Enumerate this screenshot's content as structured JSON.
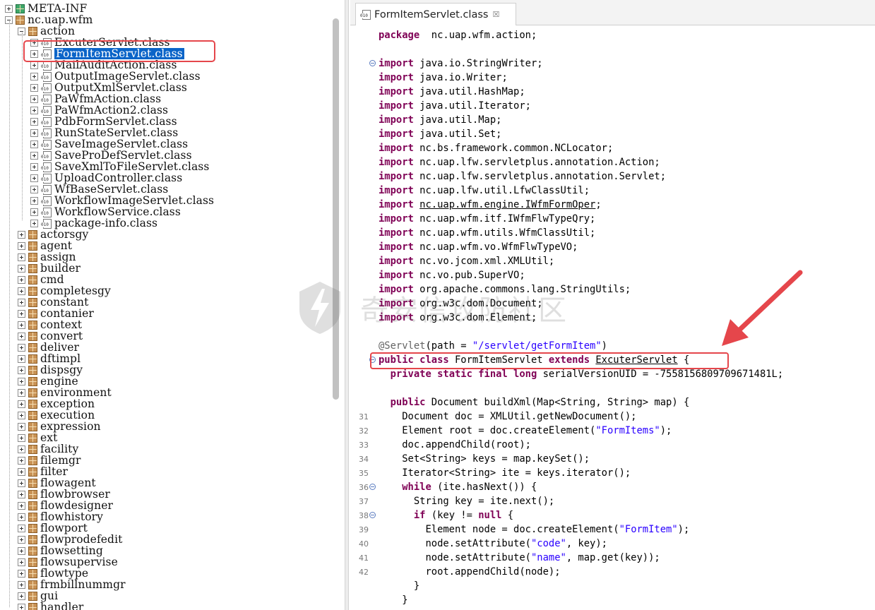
{
  "tree": {
    "items": [
      {
        "label": "META-INF",
        "level": 0,
        "expander": "plus",
        "icon": "package-green"
      },
      {
        "label": "nc.uap.wfm",
        "level": 0,
        "expander": "minus",
        "icon": "package"
      },
      {
        "label": "action",
        "level": 1,
        "expander": "minus",
        "icon": "package"
      },
      {
        "label": "ExcuterServlet.class",
        "level": 2,
        "expander": "plus",
        "icon": "class"
      },
      {
        "label": "FormItemServlet.class",
        "level": 2,
        "expander": "plus",
        "icon": "class",
        "selected": true
      },
      {
        "label": "MailAuditAction.class",
        "level": 2,
        "expander": "plus",
        "icon": "class"
      },
      {
        "label": "OutputImageServlet.class",
        "level": 2,
        "expander": "plus",
        "icon": "class"
      },
      {
        "label": "OutputXmlServlet.class",
        "level": 2,
        "expander": "plus",
        "icon": "class"
      },
      {
        "label": "PaWfmAction.class",
        "level": 2,
        "expander": "plus",
        "icon": "class"
      },
      {
        "label": "PaWfmAction2.class",
        "level": 2,
        "expander": "plus",
        "icon": "class"
      },
      {
        "label": "PdbFormServlet.class",
        "level": 2,
        "expander": "plus",
        "icon": "class"
      },
      {
        "label": "RunStateServlet.class",
        "level": 2,
        "expander": "plus",
        "icon": "class"
      },
      {
        "label": "SaveImageServlet.class",
        "level": 2,
        "expander": "plus",
        "icon": "class"
      },
      {
        "label": "SaveProDefServlet.class",
        "level": 2,
        "expander": "plus",
        "icon": "class"
      },
      {
        "label": "SaveXmlToFileServlet.class",
        "level": 2,
        "expander": "plus",
        "icon": "class"
      },
      {
        "label": "UploadController.class",
        "level": 2,
        "expander": "plus",
        "icon": "class"
      },
      {
        "label": "WfBaseServlet.class",
        "level": 2,
        "expander": "plus",
        "icon": "class"
      },
      {
        "label": "WorkflowImageServlet.class",
        "level": 2,
        "expander": "plus",
        "icon": "class"
      },
      {
        "label": "WorkflowService.class",
        "level": 2,
        "expander": "plus",
        "icon": "class"
      },
      {
        "label": "package-info.class",
        "level": 2,
        "expander": "plus",
        "icon": "class"
      },
      {
        "label": "actorsgy",
        "level": 1,
        "expander": "plus",
        "icon": "package"
      },
      {
        "label": "agent",
        "level": 1,
        "expander": "plus",
        "icon": "package"
      },
      {
        "label": "assign",
        "level": 1,
        "expander": "plus",
        "icon": "package"
      },
      {
        "label": "builder",
        "level": 1,
        "expander": "plus",
        "icon": "package"
      },
      {
        "label": "cmd",
        "level": 1,
        "expander": "plus",
        "icon": "package"
      },
      {
        "label": "completesgy",
        "level": 1,
        "expander": "plus",
        "icon": "package"
      },
      {
        "label": "constant",
        "level": 1,
        "expander": "plus",
        "icon": "package"
      },
      {
        "label": "contanier",
        "level": 1,
        "expander": "plus",
        "icon": "package"
      },
      {
        "label": "context",
        "level": 1,
        "expander": "plus",
        "icon": "package"
      },
      {
        "label": "convert",
        "level": 1,
        "expander": "plus",
        "icon": "package"
      },
      {
        "label": "deliver",
        "level": 1,
        "expander": "plus",
        "icon": "package"
      },
      {
        "label": "dftimpl",
        "level": 1,
        "expander": "plus",
        "icon": "package"
      },
      {
        "label": "dispsgy",
        "level": 1,
        "expander": "plus",
        "icon": "package"
      },
      {
        "label": "engine",
        "level": 1,
        "expander": "plus",
        "icon": "package"
      },
      {
        "label": "environment",
        "level": 1,
        "expander": "plus",
        "icon": "package"
      },
      {
        "label": "exception",
        "level": 1,
        "expander": "plus",
        "icon": "package"
      },
      {
        "label": "execution",
        "level": 1,
        "expander": "plus",
        "icon": "package"
      },
      {
        "label": "expression",
        "level": 1,
        "expander": "plus",
        "icon": "package"
      },
      {
        "label": "ext",
        "level": 1,
        "expander": "plus",
        "icon": "package"
      },
      {
        "label": "facility",
        "level": 1,
        "expander": "plus",
        "icon": "package"
      },
      {
        "label": "filemgr",
        "level": 1,
        "expander": "plus",
        "icon": "package"
      },
      {
        "label": "filter",
        "level": 1,
        "expander": "plus",
        "icon": "package"
      },
      {
        "label": "flowagent",
        "level": 1,
        "expander": "plus",
        "icon": "package"
      },
      {
        "label": "flowbrowser",
        "level": 1,
        "expander": "plus",
        "icon": "package"
      },
      {
        "label": "flowdesigner",
        "level": 1,
        "expander": "plus",
        "icon": "package"
      },
      {
        "label": "flowhistory",
        "level": 1,
        "expander": "plus",
        "icon": "package"
      },
      {
        "label": "flowport",
        "level": 1,
        "expander": "plus",
        "icon": "package"
      },
      {
        "label": "flowprodefedit",
        "level": 1,
        "expander": "plus",
        "icon": "package"
      },
      {
        "label": "flowsetting",
        "level": 1,
        "expander": "plus",
        "icon": "package"
      },
      {
        "label": "flowsupervise",
        "level": 1,
        "expander": "plus",
        "icon": "package"
      },
      {
        "label": "flowtype",
        "level": 1,
        "expander": "plus",
        "icon": "package"
      },
      {
        "label": "frmbillnummgr",
        "level": 1,
        "expander": "plus",
        "icon": "package"
      },
      {
        "label": "gui",
        "level": 1,
        "expander": "plus",
        "icon": "package"
      },
      {
        "label": "handler",
        "level": 1,
        "expander": "plus",
        "icon": "package"
      }
    ]
  },
  "editor": {
    "tab_title": "FormItemServlet.class",
    "tab_close": "☒",
    "lines": [
      {
        "num": "",
        "fold": false,
        "segs": [
          [
            "kw",
            "package"
          ],
          [
            "",
            "  nc.uap.wfm.action;"
          ]
        ]
      },
      {
        "num": "",
        "fold": false,
        "segs": []
      },
      {
        "num": "",
        "fold": true,
        "segs": [
          [
            "kw",
            "import"
          ],
          [
            "",
            " java.io.StringWriter;"
          ]
        ]
      },
      {
        "num": "",
        "fold": false,
        "segs": [
          [
            "kw",
            "import"
          ],
          [
            "",
            " java.io.Writer;"
          ]
        ]
      },
      {
        "num": "",
        "fold": false,
        "segs": [
          [
            "kw",
            "import"
          ],
          [
            "",
            " java.util.HashMap;"
          ]
        ]
      },
      {
        "num": "",
        "fold": false,
        "segs": [
          [
            "kw",
            "import"
          ],
          [
            "",
            " java.util.Iterator;"
          ]
        ]
      },
      {
        "num": "",
        "fold": false,
        "segs": [
          [
            "kw",
            "import"
          ],
          [
            "",
            " java.util.Map;"
          ]
        ]
      },
      {
        "num": "",
        "fold": false,
        "segs": [
          [
            "kw",
            "import"
          ],
          [
            "",
            " java.util.Set;"
          ]
        ]
      },
      {
        "num": "",
        "fold": false,
        "segs": [
          [
            "kw",
            "import"
          ],
          [
            "",
            " nc.bs.framework.common.NCLocator;"
          ]
        ]
      },
      {
        "num": "",
        "fold": false,
        "segs": [
          [
            "kw",
            "import"
          ],
          [
            "",
            " nc.uap.lfw.servletplus.annotation.Action;"
          ]
        ]
      },
      {
        "num": "",
        "fold": false,
        "segs": [
          [
            "kw",
            "import"
          ],
          [
            "",
            " nc.uap.lfw.servletplus.annotation.Servlet;"
          ]
        ]
      },
      {
        "num": "",
        "fold": false,
        "segs": [
          [
            "kw",
            "import"
          ],
          [
            "",
            " nc.uap.lfw.util.LfwClassUtil;"
          ]
        ]
      },
      {
        "num": "",
        "fold": false,
        "segs": [
          [
            "kw",
            "import"
          ],
          [
            "",
            " "
          ],
          [
            "ul",
            "nc.uap.wfm.engine.IWfmFormOper"
          ],
          [
            "",
            ";"
          ]
        ]
      },
      {
        "num": "",
        "fold": false,
        "segs": [
          [
            "kw",
            "import"
          ],
          [
            "",
            " nc.uap.wfm.itf.IWfmFlwTypeQry;"
          ]
        ]
      },
      {
        "num": "",
        "fold": false,
        "segs": [
          [
            "kw",
            "import"
          ],
          [
            "",
            " nc.uap.wfm.utils.WfmClassUtil;"
          ]
        ]
      },
      {
        "num": "",
        "fold": false,
        "segs": [
          [
            "kw",
            "import"
          ],
          [
            "",
            " nc.uap.wfm.vo.WfmFlwTypeVO;"
          ]
        ]
      },
      {
        "num": "",
        "fold": false,
        "segs": [
          [
            "kw",
            "import"
          ],
          [
            "",
            " nc.vo.jcom.xml.XMLUtil;"
          ]
        ]
      },
      {
        "num": "",
        "fold": false,
        "segs": [
          [
            "kw",
            "import"
          ],
          [
            "",
            " nc.vo.pub.SuperVO;"
          ]
        ]
      },
      {
        "num": "",
        "fold": false,
        "segs": [
          [
            "kw",
            "import"
          ],
          [
            "",
            " org.apache.commons.lang.StringUtils;"
          ]
        ]
      },
      {
        "num": "",
        "fold": false,
        "segs": [
          [
            "kw",
            "import"
          ],
          [
            "",
            " org.w3c.dom.Document;"
          ]
        ]
      },
      {
        "num": "",
        "fold": false,
        "segs": [
          [
            "kw",
            "import"
          ],
          [
            "",
            " org.w3c.dom.Element;"
          ]
        ]
      },
      {
        "num": "",
        "fold": false,
        "segs": []
      },
      {
        "num": "",
        "fold": false,
        "segs": [
          [
            "ann",
            "@Servlet"
          ],
          [
            "",
            "(path = "
          ],
          [
            "str",
            "\"/servlet/getFormItem\""
          ],
          [
            "",
            ")"
          ]
        ]
      },
      {
        "num": "",
        "fold": true,
        "segs": [
          [
            "kw",
            "public class"
          ],
          [
            "",
            " FormItemServlet "
          ],
          [
            "kw",
            "extends"
          ],
          [
            "",
            " "
          ],
          [
            "ul",
            "ExcuterServlet"
          ],
          [
            "",
            " {"
          ]
        ]
      },
      {
        "num": "",
        "fold": false,
        "segs": [
          [
            "",
            "  "
          ],
          [
            "kw",
            "private static final long"
          ],
          [
            "",
            " serialVersionUID = -7558156809709671481L;"
          ]
        ]
      },
      {
        "num": "",
        "fold": false,
        "segs": []
      },
      {
        "num": "",
        "fold": false,
        "segs": [
          [
            "",
            "  "
          ],
          [
            "kw",
            "public"
          ],
          [
            "",
            " Document buildXml(Map<String, String> map) {"
          ]
        ]
      },
      {
        "num": "31",
        "fold": false,
        "segs": [
          [
            "",
            "    Document doc = XMLUtil.getNewDocument();"
          ]
        ]
      },
      {
        "num": "32",
        "fold": false,
        "segs": [
          [
            "",
            "    Element root = doc.createElement("
          ],
          [
            "str",
            "\"FormItems\""
          ],
          [
            "",
            ");"
          ]
        ]
      },
      {
        "num": "33",
        "fold": false,
        "segs": [
          [
            "",
            "    doc.appendChild(root);"
          ]
        ]
      },
      {
        "num": "34",
        "fold": false,
        "segs": [
          [
            "",
            "    Set<String> keys = map.keySet();"
          ]
        ]
      },
      {
        "num": "35",
        "fold": false,
        "segs": [
          [
            "",
            "    Iterator<String> ite = keys.iterator();"
          ]
        ]
      },
      {
        "num": "36",
        "fold": true,
        "segs": [
          [
            "",
            "    "
          ],
          [
            "kw",
            "while"
          ],
          [
            "",
            " (ite.hasNext()) {"
          ]
        ]
      },
      {
        "num": "37",
        "fold": false,
        "segs": [
          [
            "",
            "      String key = ite.next();"
          ]
        ]
      },
      {
        "num": "38",
        "fold": true,
        "segs": [
          [
            "",
            "      "
          ],
          [
            "kw",
            "if"
          ],
          [
            "",
            " (key != "
          ],
          [
            "kw",
            "null"
          ],
          [
            "",
            " {"
          ]
        ]
      },
      {
        "num": "39",
        "fold": false,
        "segs": [
          [
            "",
            "        Element node = doc.createElement("
          ],
          [
            "str",
            "\"FormItem\""
          ],
          [
            "",
            ");"
          ]
        ]
      },
      {
        "num": "40",
        "fold": false,
        "segs": [
          [
            "",
            "        node.setAttribute("
          ],
          [
            "str",
            "\"code\""
          ],
          [
            "",
            ", key);"
          ]
        ]
      },
      {
        "num": "41",
        "fold": false,
        "segs": [
          [
            "",
            "        node.setAttribute("
          ],
          [
            "str",
            "\"name\""
          ],
          [
            "",
            ", map.get(key));"
          ]
        ]
      },
      {
        "num": "42",
        "fold": false,
        "segs": [
          [
            "",
            "        root.appendChild(node);"
          ]
        ]
      },
      {
        "num": "",
        "fold": false,
        "segs": [
          [
            "",
            "      }"
          ]
        ]
      },
      {
        "num": "",
        "fold": false,
        "segs": [
          [
            "",
            "    }"
          ]
        ]
      }
    ]
  },
  "watermark": {
    "text": "奇安信攻防社区"
  },
  "colors": {
    "keyword": "#7f0055",
    "string": "#2a00ff",
    "annotation": "#646464",
    "selection": "#0a64c8",
    "highlight_box": "#e5464b"
  }
}
